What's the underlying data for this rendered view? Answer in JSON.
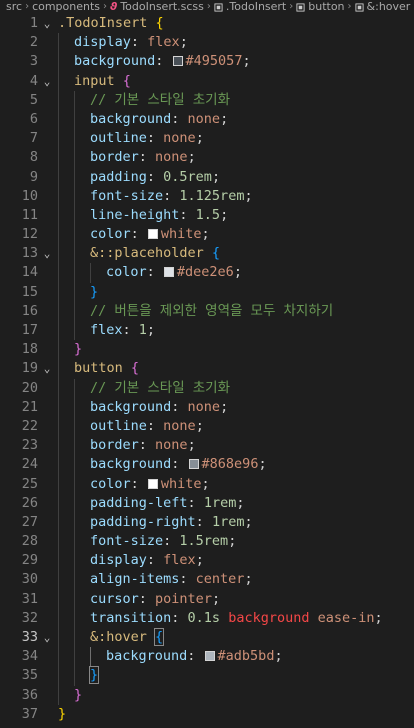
{
  "breadcrumb": {
    "items": [
      "src",
      "components",
      "TodoInsert.scss",
      ".TodoInsert",
      "button",
      "&:hover"
    ],
    "icons": [
      "",
      "",
      "scss-file-icon",
      "symbol-class-icon",
      "symbol-class-icon",
      "symbol-class-icon"
    ]
  },
  "colors": {
    "background": "#1e1e1e",
    "selector": "#d7ba7d",
    "property": "#9cdcfe",
    "value": "#ce9178",
    "number": "#b5cea8",
    "comment": "#6a9955"
  },
  "active_line": 33,
  "lines": [
    {
      "n": "1",
      "fold": "v",
      "indent": 0,
      "tokens": [
        [
          ".TodoInsert ",
          "sel"
        ],
        [
          "{",
          "b1"
        ]
      ]
    },
    {
      "n": "2",
      "fold": "",
      "indent": 1,
      "tokens": [
        [
          "display",
          "prop"
        ],
        [
          ": ",
          "punc"
        ],
        [
          "flex",
          "val"
        ],
        [
          ";",
          "punc"
        ]
      ]
    },
    {
      "n": "3",
      "fold": "",
      "indent": 1,
      "tokens": [
        [
          "background",
          "prop"
        ],
        [
          ": ",
          "punc"
        ],
        [
          "#495057",
          "swatch"
        ],
        [
          "#495057",
          "val"
        ],
        [
          ";",
          "punc"
        ]
      ]
    },
    {
      "n": "4",
      "fold": "v",
      "indent": 1,
      "tokens": [
        [
          "input ",
          "sel"
        ],
        [
          "{",
          "b2"
        ]
      ]
    },
    {
      "n": "5",
      "fold": "",
      "indent": 2,
      "tokens": [
        [
          "// 기본 스타일 초기화",
          "cmt"
        ]
      ]
    },
    {
      "n": "6",
      "fold": "",
      "indent": 2,
      "tokens": [
        [
          "background",
          "prop"
        ],
        [
          ": ",
          "punc"
        ],
        [
          "none",
          "val"
        ],
        [
          ";",
          "punc"
        ]
      ]
    },
    {
      "n": "7",
      "fold": "",
      "indent": 2,
      "tokens": [
        [
          "outline",
          "prop"
        ],
        [
          ": ",
          "punc"
        ],
        [
          "none",
          "val"
        ],
        [
          ";",
          "punc"
        ]
      ]
    },
    {
      "n": "8",
      "fold": "",
      "indent": 2,
      "tokens": [
        [
          "border",
          "prop"
        ],
        [
          ": ",
          "punc"
        ],
        [
          "none",
          "val"
        ],
        [
          ";",
          "punc"
        ]
      ]
    },
    {
      "n": "9",
      "fold": "",
      "indent": 2,
      "tokens": [
        [
          "padding",
          "prop"
        ],
        [
          ": ",
          "punc"
        ],
        [
          "0.5rem",
          "num"
        ],
        [
          ";",
          "punc"
        ]
      ]
    },
    {
      "n": "10",
      "fold": "",
      "indent": 2,
      "tokens": [
        [
          "font-size",
          "prop"
        ],
        [
          ": ",
          "punc"
        ],
        [
          "1.125rem",
          "num"
        ],
        [
          ";",
          "punc"
        ]
      ]
    },
    {
      "n": "11",
      "fold": "",
      "indent": 2,
      "tokens": [
        [
          "line-height",
          "prop"
        ],
        [
          ": ",
          "punc"
        ],
        [
          "1.5",
          "num"
        ],
        [
          ";",
          "punc"
        ]
      ]
    },
    {
      "n": "12",
      "fold": "",
      "indent": 2,
      "tokens": [
        [
          "color",
          "prop"
        ],
        [
          ": ",
          "punc"
        ],
        [
          "#ffffff",
          "swatch"
        ],
        [
          "white",
          "val"
        ],
        [
          ";",
          "punc"
        ]
      ]
    },
    {
      "n": "13",
      "fold": "v",
      "indent": 2,
      "tokens": [
        [
          "&::placeholder ",
          "sel"
        ],
        [
          "{",
          "b3"
        ]
      ]
    },
    {
      "n": "14",
      "fold": "",
      "indent": 3,
      "tokens": [
        [
          "color",
          "prop"
        ],
        [
          ": ",
          "punc"
        ],
        [
          "#dee2e6",
          "swatch"
        ],
        [
          "#dee2e6",
          "val"
        ],
        [
          ";",
          "punc"
        ]
      ]
    },
    {
      "n": "15",
      "fold": "",
      "indent": 2,
      "tokens": [
        [
          "}",
          "b3"
        ]
      ]
    },
    {
      "n": "16",
      "fold": "",
      "indent": 2,
      "tokens": [
        [
          "// 버튼을 제외한 영역을 모두 차지하기",
          "cmt"
        ]
      ]
    },
    {
      "n": "17",
      "fold": "",
      "indent": 2,
      "tokens": [
        [
          "flex",
          "prop"
        ],
        [
          ": ",
          "punc"
        ],
        [
          "1",
          "num"
        ],
        [
          ";",
          "punc"
        ]
      ]
    },
    {
      "n": "18",
      "fold": "",
      "indent": 1,
      "tokens": [
        [
          "}",
          "b2"
        ]
      ]
    },
    {
      "n": "19",
      "fold": "v",
      "indent": 1,
      "tokens": [
        [
          "button ",
          "sel"
        ],
        [
          "{",
          "b2"
        ]
      ]
    },
    {
      "n": "20",
      "fold": "",
      "indent": 2,
      "tokens": [
        [
          "// 기본 스타일 초기화",
          "cmt"
        ]
      ]
    },
    {
      "n": "21",
      "fold": "",
      "indent": 2,
      "tokens": [
        [
          "background",
          "prop"
        ],
        [
          ": ",
          "punc"
        ],
        [
          "none",
          "val"
        ],
        [
          ";",
          "punc"
        ]
      ]
    },
    {
      "n": "22",
      "fold": "",
      "indent": 2,
      "tokens": [
        [
          "outline",
          "prop"
        ],
        [
          ": ",
          "punc"
        ],
        [
          "none",
          "val"
        ],
        [
          ";",
          "punc"
        ]
      ]
    },
    {
      "n": "23",
      "fold": "",
      "indent": 2,
      "tokens": [
        [
          "border",
          "prop"
        ],
        [
          ": ",
          "punc"
        ],
        [
          "none",
          "val"
        ],
        [
          ";",
          "punc"
        ]
      ]
    },
    {
      "n": "24",
      "fold": "",
      "indent": 2,
      "tokens": [
        [
          "background",
          "prop"
        ],
        [
          ": ",
          "punc"
        ],
        [
          "#868e96",
          "swatch"
        ],
        [
          "#868e96",
          "val"
        ],
        [
          ";",
          "punc"
        ]
      ]
    },
    {
      "n": "25",
      "fold": "",
      "indent": 2,
      "tokens": [
        [
          "color",
          "prop"
        ],
        [
          ": ",
          "punc"
        ],
        [
          "#ffffff",
          "swatch"
        ],
        [
          "white",
          "val"
        ],
        [
          ";",
          "punc"
        ]
      ]
    },
    {
      "n": "26",
      "fold": "",
      "indent": 2,
      "tokens": [
        [
          "padding-left",
          "prop"
        ],
        [
          ": ",
          "punc"
        ],
        [
          "1rem",
          "num"
        ],
        [
          ";",
          "punc"
        ]
      ]
    },
    {
      "n": "27",
      "fold": "",
      "indent": 2,
      "tokens": [
        [
          "padding-right",
          "prop"
        ],
        [
          ": ",
          "punc"
        ],
        [
          "1rem",
          "num"
        ],
        [
          ";",
          "punc"
        ]
      ]
    },
    {
      "n": "28",
      "fold": "",
      "indent": 2,
      "tokens": [
        [
          "font-size",
          "prop"
        ],
        [
          ": ",
          "punc"
        ],
        [
          "1.5rem",
          "num"
        ],
        [
          ";",
          "punc"
        ]
      ]
    },
    {
      "n": "29",
      "fold": "",
      "indent": 2,
      "tokens": [
        [
          "display",
          "prop"
        ],
        [
          ": ",
          "punc"
        ],
        [
          "flex",
          "val"
        ],
        [
          ";",
          "punc"
        ]
      ]
    },
    {
      "n": "30",
      "fold": "",
      "indent": 2,
      "tokens": [
        [
          "align-items",
          "prop"
        ],
        [
          ": ",
          "punc"
        ],
        [
          "center",
          "val"
        ],
        [
          ";",
          "punc"
        ]
      ]
    },
    {
      "n": "31",
      "fold": "",
      "indent": 2,
      "tokens": [
        [
          "cursor",
          "prop"
        ],
        [
          ": ",
          "punc"
        ],
        [
          "pointer",
          "val"
        ],
        [
          ";",
          "punc"
        ]
      ]
    },
    {
      "n": "32",
      "fold": "",
      "indent": 2,
      "tokens": [
        [
          "transition",
          "prop"
        ],
        [
          ": ",
          "punc"
        ],
        [
          "0.1s",
          "num"
        ],
        [
          " ",
          "punc"
        ],
        [
          "background",
          "kw"
        ],
        [
          " ",
          "punc"
        ],
        [
          "ease-in",
          "val"
        ],
        [
          ";",
          "punc"
        ]
      ]
    },
    {
      "n": "33",
      "fold": "v",
      "indent": 2,
      "tokens": [
        [
          "&:hover ",
          "sel"
        ],
        [
          "{",
          "b3"
        ]
      ]
    },
    {
      "n": "34",
      "fold": "",
      "indent": 3,
      "tokens": [
        [
          "background",
          "prop"
        ],
        [
          ": ",
          "punc"
        ],
        [
          "#adb5bd",
          "swatch"
        ],
        [
          "#adb5bd",
          "val"
        ],
        [
          ";",
          "punc"
        ]
      ]
    },
    {
      "n": "35",
      "fold": "",
      "indent": 2,
      "tokens": [
        [
          "}",
          "b3"
        ]
      ]
    },
    {
      "n": "36",
      "fold": "",
      "indent": 1,
      "tokens": [
        [
          "}",
          "b2"
        ]
      ]
    },
    {
      "n": "37",
      "fold": "",
      "indent": 0,
      "tokens": [
        [
          "}",
          "b1"
        ]
      ]
    }
  ]
}
